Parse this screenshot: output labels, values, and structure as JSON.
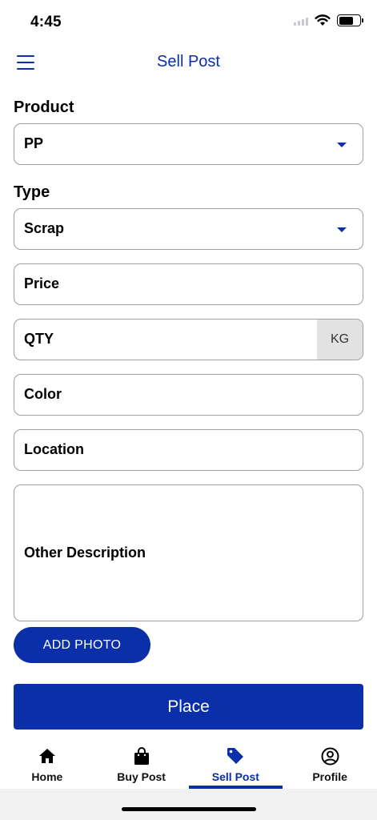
{
  "status": {
    "time": "4:45"
  },
  "header": {
    "title": "Sell Post"
  },
  "form": {
    "product": {
      "label": "Product",
      "value": "PP"
    },
    "type": {
      "label": "Type",
      "value": "Scrap"
    },
    "price": {
      "placeholder": "Price"
    },
    "qty": {
      "placeholder": "QTY",
      "unit": "KG"
    },
    "color": {
      "placeholder": "Color"
    },
    "location": {
      "placeholder": "Location"
    },
    "description": {
      "placeholder": "Other Description"
    }
  },
  "actions": {
    "add_photo": "ADD PHOTO",
    "place": "Place"
  },
  "nav": {
    "items": [
      {
        "label": "Home",
        "icon": "home-icon"
      },
      {
        "label": "Buy Post",
        "icon": "shopping-bag-icon"
      },
      {
        "label": "Sell Post",
        "icon": "tag-icon",
        "active": true
      },
      {
        "label": "Profile",
        "icon": "profile-icon"
      }
    ]
  },
  "colors": {
    "primary": "#0a2fa8",
    "border": "#9e9e9e",
    "unit_bg": "#e2e2e2"
  }
}
